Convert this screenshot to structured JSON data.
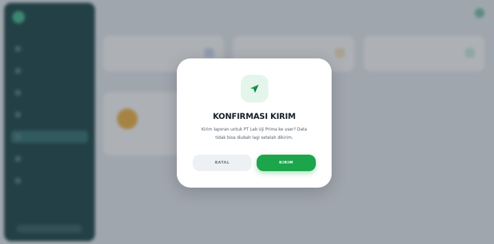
{
  "background": {
    "brand": "",
    "nav_items": [
      "",
      "",
      "",
      "",
      "",
      "",
      ""
    ],
    "active_index": 4,
    "sidebar_footer": "",
    "page_title": "",
    "user_name": "",
    "stats": [
      {
        "label": "",
        "value": "",
        "icon": "doc-icon",
        "color": "#cfdcf4"
      },
      {
        "label": "",
        "value": "",
        "icon": "clock-icon",
        "color": "#f6e3b8"
      },
      {
        "label": "",
        "value": "",
        "icon": "check-icon",
        "color": "#cdeedd"
      }
    ],
    "section_title": "",
    "panel_name": "",
    "panel_sub": "",
    "link_text": ""
  },
  "modal": {
    "icon": "send-icon",
    "title": "KONFIRMASI KIRIM",
    "message_line1": "Kirim laporan untuk PT Lab Uji Prima ke user? Data",
    "message_line2": "tidak bisa diubah lagi setelah dikirim.",
    "cancel_label": "BATAL",
    "send_label": "KIRIM"
  },
  "colors": {
    "accent": "#1da54b",
    "sidebar": "#103d3d"
  }
}
